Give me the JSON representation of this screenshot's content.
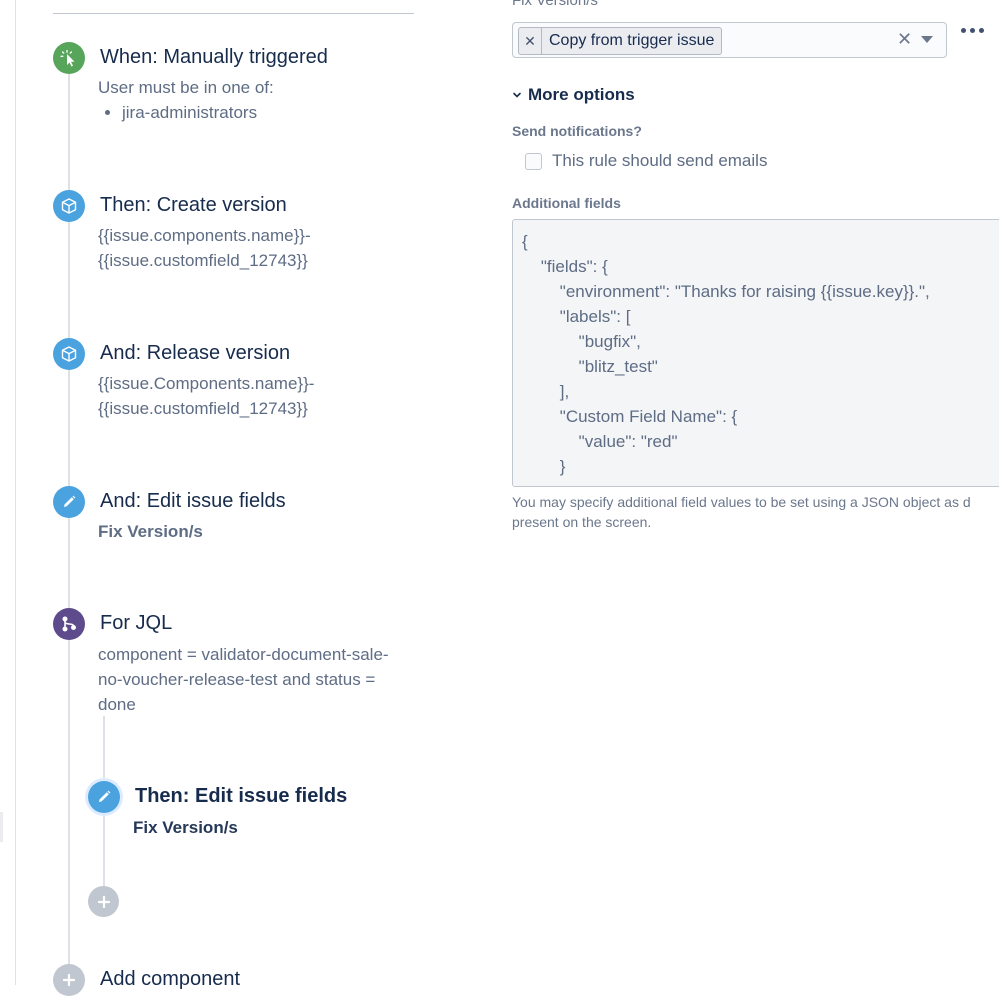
{
  "rule": {
    "trigger": {
      "title": "When: Manually triggered",
      "sub": "User must be in one of:",
      "groups": [
        "jira-administrators"
      ]
    },
    "actions": [
      {
        "title": "Then: Create version",
        "lines": [
          "{{issue.components.name}}-",
          "{{issue.customfield_12743}}"
        ]
      },
      {
        "title": "And: Release version",
        "lines": [
          "{{issue.Components.name}}-",
          "{{issue.customfield_12743}}"
        ]
      },
      {
        "title": "And: Edit issue fields",
        "sub": "Fix Version/s"
      }
    ],
    "branch": {
      "title": "For JQL",
      "lines": [
        "component = validator-document-sale-",
        "no-voucher-release-test and status =",
        "done"
      ],
      "child": {
        "title": "Then: Edit issue fields",
        "sub": "Fix Version/s"
      }
    },
    "add_component": "Add component"
  },
  "editor": {
    "fix_version_label": "Fix Version/s",
    "fix_version_value": "Copy from trigger issue",
    "more_options": "More options",
    "send_notifications_label": "Send notifications?",
    "send_emails_label": "This rule should send emails",
    "send_emails_checked": false,
    "additional_fields_label": "Additional fields",
    "json_lines": [
      "{",
      "    \"fields\": {",
      "        \"environment\": \"Thanks for raising {{issue.key}}.\",",
      "        \"labels\": [",
      "            \"bugfix\",",
      "            \"blitz_test\"",
      "        ],",
      "        \"Custom Field Name\": {",
      "            \"value\": \"red\"",
      "        }"
    ],
    "helper_line1": "You may specify additional field values to be set using a JSON object as d",
    "helper_line2": "present on the screen."
  },
  "colors": {
    "action_icon": "#4aa3df",
    "trigger_icon": "#57a55a",
    "branch_icon": "#5e4b8b",
    "add_icon": "#c1c7d0"
  },
  "icons": [
    "cursor-click-icon",
    "box-icon",
    "pencil-icon",
    "branch-icon",
    "plus-icon",
    "close-icon",
    "chevron-down-icon",
    "more-icon"
  ]
}
